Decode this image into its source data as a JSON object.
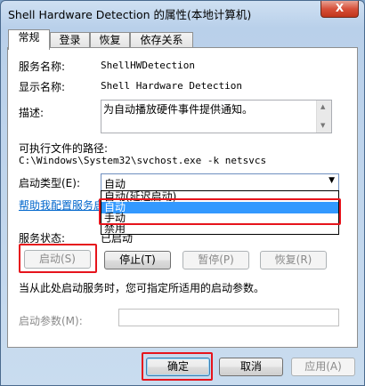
{
  "window": {
    "title": "Shell Hardware Detection 的属性(本地计算机)",
    "close_label": "X"
  },
  "tabs": [
    {
      "label": "常规",
      "active": true
    },
    {
      "label": "登录",
      "active": false
    },
    {
      "label": "恢复",
      "active": false
    },
    {
      "label": "依存关系",
      "active": false
    }
  ],
  "general": {
    "service_name_label": "服务名称:",
    "service_name": "ShellHWDetection",
    "display_name_label": "显示名称:",
    "display_name": "Shell Hardware Detection",
    "description_label": "描述:",
    "description": "为自动播放硬件事件提供通知。",
    "exe_path_label": "可执行文件的路径:",
    "exe_path": "C:\\Windows\\System32\\svchost.exe -k netsvcs",
    "startup_type_label": "启动类型(E):",
    "startup_type_value": "自动",
    "startup_options": [
      "自动(延迟启动)",
      "自动",
      "手动",
      "禁用"
    ],
    "startup_selected_index": 1,
    "help_link": "帮助我配置服务启",
    "status_label": "服务状态:",
    "status_value": "已启动",
    "start_hint": "当从此处启动服务时，您可指定所适用的启动参数。",
    "params_label": "启动参数(M):",
    "params_value": ""
  },
  "service_buttons": {
    "start": "启动(S)",
    "stop": "停止(T)",
    "pause": "暂停(P)",
    "resume": "恢复(R)"
  },
  "dialog_buttons": {
    "ok": "确定",
    "cancel": "取消",
    "apply": "应用(A)"
  },
  "colors": {
    "highlight": "#e6141c",
    "selection": "#3399ff",
    "link": "#0066cc"
  }
}
